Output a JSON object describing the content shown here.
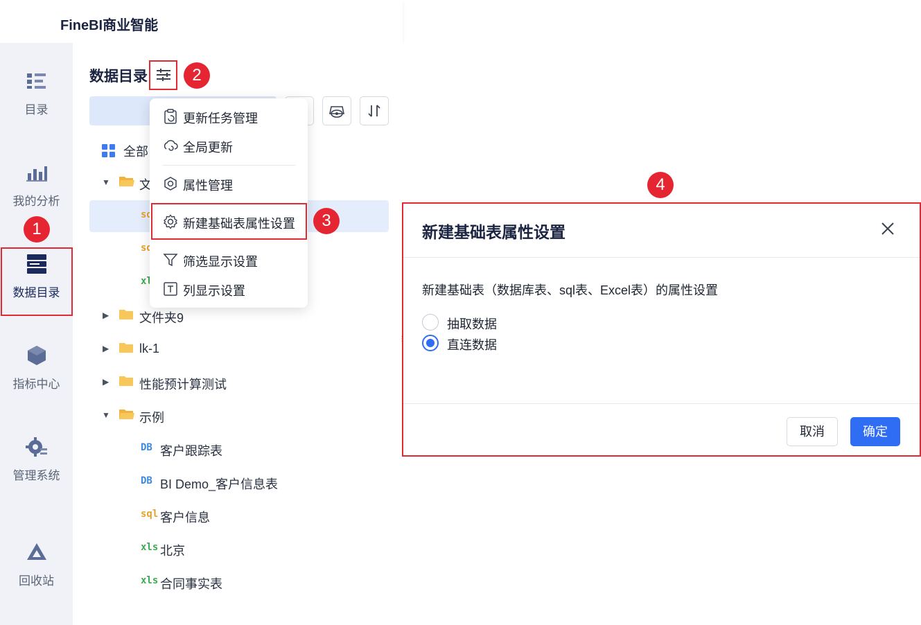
{
  "app": {
    "brand": "FineBI商业智能"
  },
  "leftnav": {
    "items": [
      {
        "label": "目录",
        "icon": "catalog-icon"
      },
      {
        "label": "我的分析",
        "icon": "analysis-icon"
      },
      {
        "label": "数据目录",
        "icon": "data-catalog-icon",
        "active": true
      },
      {
        "label": "指标中心",
        "icon": "metrics-icon"
      },
      {
        "label": "管理系统",
        "icon": "settings-gear-icon"
      },
      {
        "label": "回收站",
        "icon": "recycle-icon"
      }
    ]
  },
  "panel": {
    "title": "数据目录",
    "tree": [
      {
        "label": "全部",
        "kind": "all"
      },
      {
        "label": "文",
        "kind": "folder-open"
      },
      {
        "label": "",
        "kind": "sql",
        "selected": true
      },
      {
        "label": "",
        "kind": "sql"
      },
      {
        "label": "",
        "kind": "xls"
      },
      {
        "label": "文件夹9",
        "kind": "folder"
      },
      {
        "label": "lk-1",
        "kind": "folder"
      },
      {
        "label": "性能预计算测试",
        "kind": "folder"
      },
      {
        "label": "示例",
        "kind": "folder-open"
      },
      {
        "label": "客户跟踪表",
        "kind": "db"
      },
      {
        "label": "BI Demo_客户信息表",
        "kind": "db"
      },
      {
        "label": "客户信息",
        "kind": "sql"
      },
      {
        "label": "北京",
        "kind": "xls"
      },
      {
        "label": "合同事实表",
        "kind": "xls"
      }
    ],
    "tags": {
      "db": "DB",
      "sql": "sql",
      "xls": "xls"
    }
  },
  "menu": {
    "items": [
      {
        "label": "更新任务管理",
        "icon": "clipboard-refresh-icon"
      },
      {
        "label": "全局更新",
        "icon": "cloud-refresh-icon"
      },
      {
        "label": "属性管理",
        "icon": "hexagon-settings-icon"
      },
      {
        "label": "新建基础表属性设置",
        "icon": "gear-icon"
      },
      {
        "label": "筛选显示设置",
        "icon": "filter-icon"
      },
      {
        "label": "列显示设置",
        "icon": "text-column-icon"
      }
    ]
  },
  "dialog": {
    "title": "新建基础表属性设置",
    "description": "新建基础表（数据库表、sql表、Excel表）的属性设置",
    "options": [
      {
        "label": "抽取数据",
        "checked": false
      },
      {
        "label": "直连数据",
        "checked": true
      }
    ],
    "cancel": "取消",
    "ok": "确定"
  },
  "annotations": {
    "b1": "1",
    "b2": "2",
    "b3": "3",
    "b4": "4"
  },
  "colors": {
    "accent": "#2f6df5",
    "highlight": "#e02b35",
    "badge": "#e52531",
    "selected_row": "#e4edfc"
  }
}
